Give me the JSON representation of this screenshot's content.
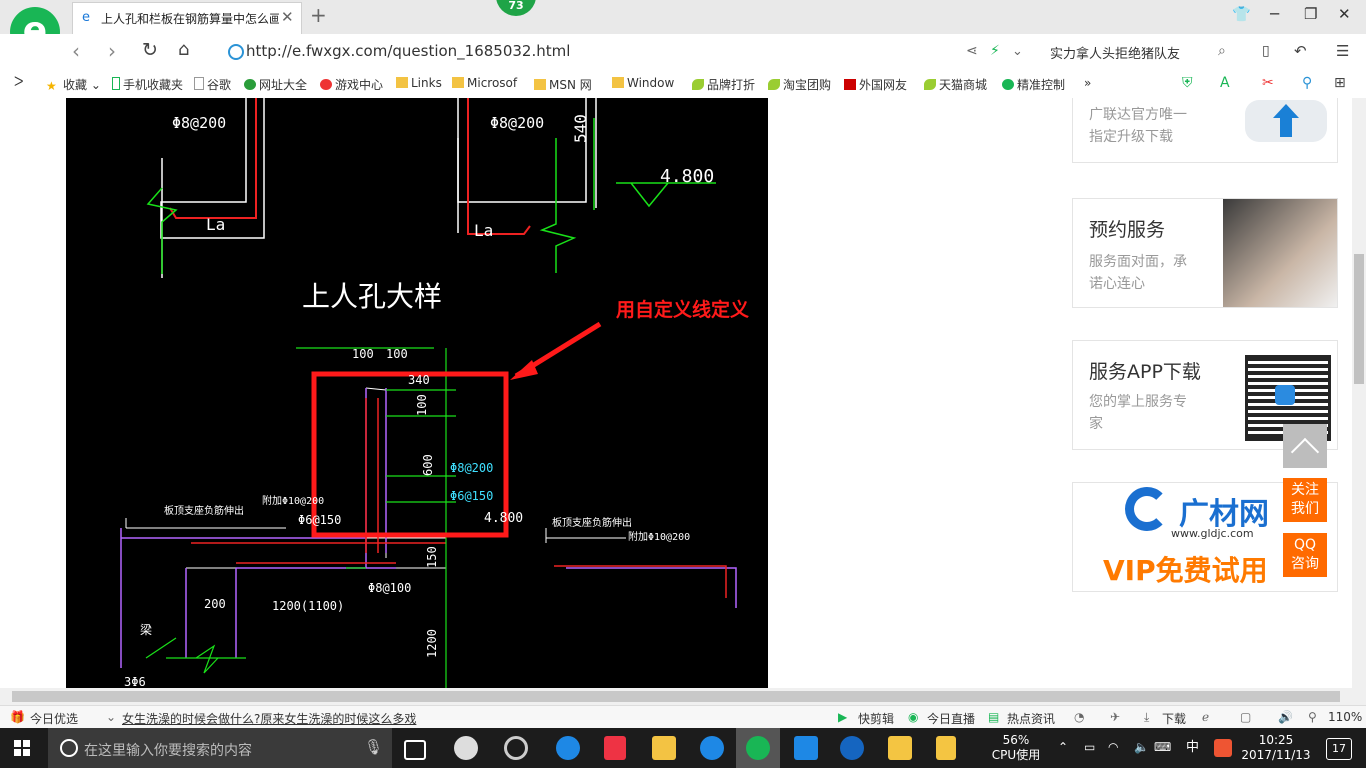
{
  "browser": {
    "tab_title": "上人孔和栏板在钢筋算量中怎么画",
    "badge_count": "73",
    "url": "http://e.fwxgx.com/question_1685032.html",
    "search_text": "实力拿人头拒绝猪队友",
    "zoom": "110%"
  },
  "bookmarks": [
    "收藏",
    "手机收藏夹",
    "谷歌",
    "网址大全",
    "游戏中心",
    "Links",
    "Microsof",
    "MSN 网",
    "Window",
    "品牌打折",
    "淘宝团购",
    "外国网友",
    "天猫商城",
    "精准控制"
  ],
  "drawing": {
    "labels_top": [
      "Φ8@200",
      "La",
      "Φ8@200",
      "540",
      "La",
      "4.800"
    ],
    "title": "上人孔大样",
    "annotation": "用自定义线定义",
    "dims": [
      "100",
      "100",
      "340",
      "100",
      "600",
      "Φ8@200",
      "Φ6@150",
      "4.800",
      "150",
      "1200",
      "200",
      "1200(1100)",
      "Φ8@100",
      "Φ6@150",
      "附加Φ10@200",
      "附加Φ10@200",
      "板顶支座负筋伸出",
      "板顶支座负筋伸出",
      "梁",
      "3Φ6"
    ]
  },
  "sidebar": {
    "card1": {
      "line1": "广联达官方唯一",
      "line2": "指定升级下载"
    },
    "card2": {
      "title": "预约服务",
      "line1": "服务面对面，承",
      "line2": "诺心连心"
    },
    "card3": {
      "title": "服务APP下载",
      "line1": "您的掌上服务专",
      "line2": "家"
    },
    "ad": {
      "brand": "广材网",
      "url": "www.gldjc.com",
      "slogan": "VIP免费试用"
    },
    "follow": "关注我们",
    "qq": "QQ咨询"
  },
  "statusbar": {
    "today": "今日优选",
    "headline": "女生洗澡的时候会做什么?原来女生洗澡的时候这么多戏",
    "items": [
      "快剪辑",
      "今日直播",
      "热点资讯",
      "下载"
    ]
  },
  "taskbar": {
    "search_placeholder": "在这里输入你要搜索的内容",
    "cpu_percent": "56%",
    "cpu_label": "CPU使用",
    "ime": "中",
    "time": "10:25",
    "date": "2017/11/13",
    "notifications": "17"
  }
}
